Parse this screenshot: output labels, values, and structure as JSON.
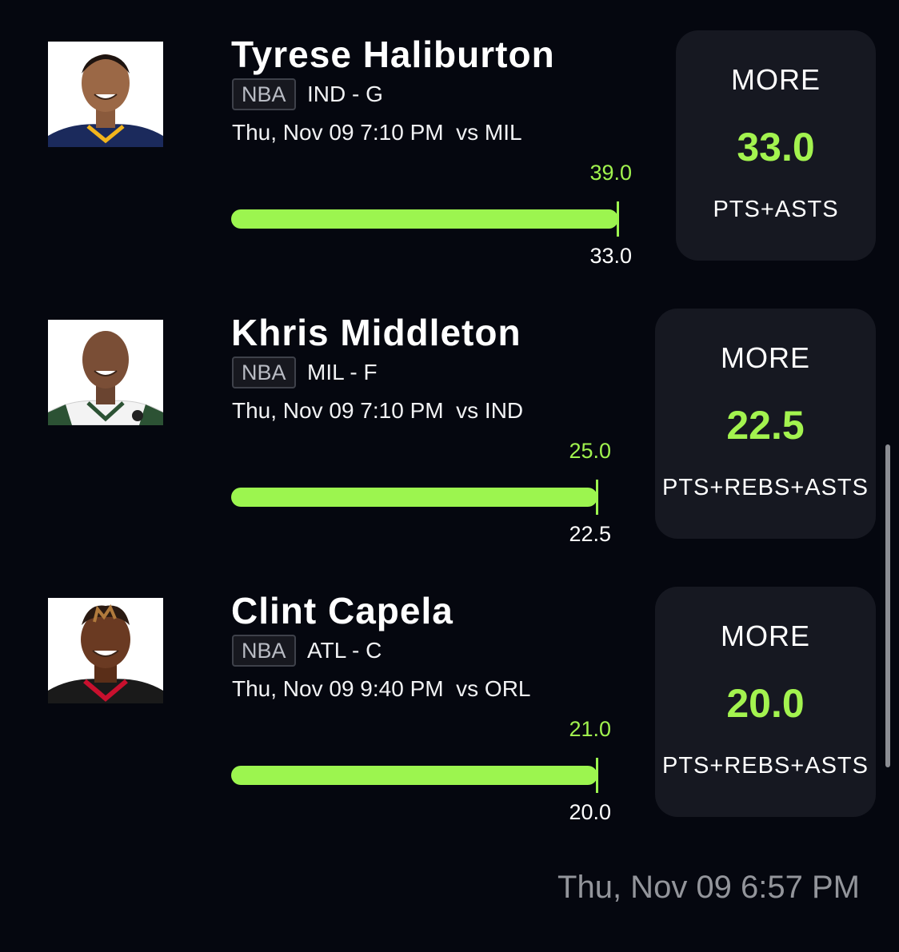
{
  "picks": [
    {
      "name": "Tyrese Haliburton",
      "league": "NBA",
      "team_position": "IND - G",
      "game": "Thu, Nov 09 7:10 PM  vs MIL",
      "actual": "39.0",
      "line": "33.0",
      "direction": "MORE",
      "line_value": "33.0",
      "stat": "PTS+ASTS",
      "progress": 1.0,
      "jersey_color": "#1b2a5c"
    },
    {
      "name": "Khris Middleton",
      "league": "NBA",
      "team_position": "MIL - F",
      "game": "Thu, Nov 09 7:10 PM  vs IND",
      "actual": "25.0",
      "line": "22.5",
      "direction": "MORE",
      "line_value": "22.5",
      "stat": "PTS+REBS+ASTS",
      "progress": 1.0,
      "jersey_color": "#f3f3f3"
    },
    {
      "name": "Clint Capela",
      "league": "NBA",
      "team_position": "ATL - C",
      "game": "Thu, Nov 09 9:40 PM  vs ORL",
      "actual": "21.0",
      "line": "20.0",
      "direction": "MORE",
      "line_value": "20.0",
      "stat": "PTS+REBS+ASTS",
      "progress": 1.0,
      "jersey_color": "#1a1a1a"
    }
  ],
  "footer": {
    "timestamp": "Thu, Nov 09 6:57 PM"
  },
  "colors": {
    "background": "#05070f",
    "card": "#161821",
    "accent_green": "#9cf54f",
    "muted": "#93959b"
  }
}
